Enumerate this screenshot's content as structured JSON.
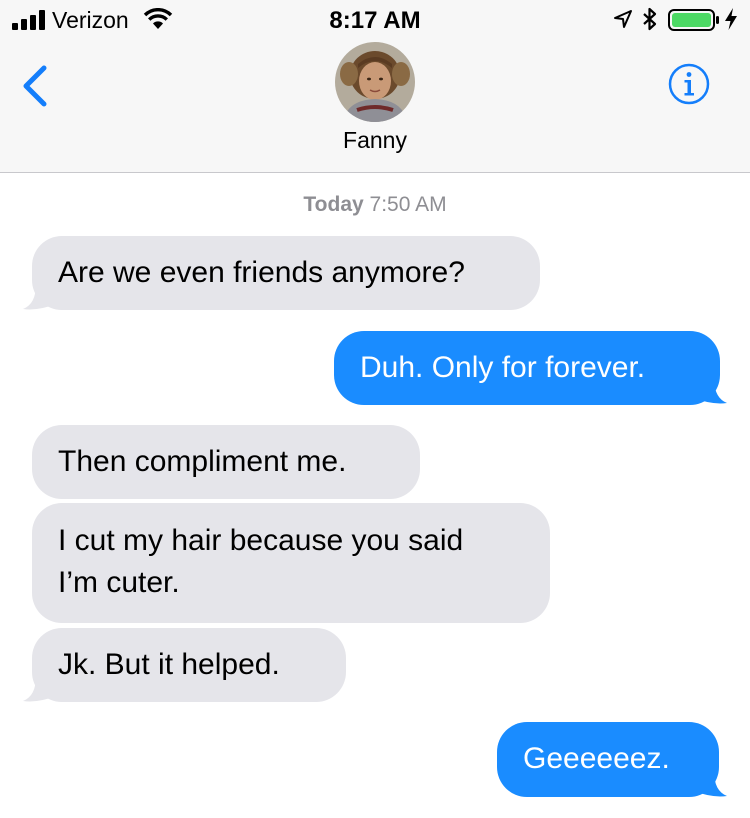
{
  "status_bar": {
    "carrier": "Verizon",
    "time": "8:17 AM"
  },
  "nav": {
    "contact_name": "Fanny",
    "accent_color": "#147efb"
  },
  "conversation": {
    "timestamp_day": "Today",
    "timestamp_time": "7:50 AM",
    "messages": [
      {
        "direction": "incoming",
        "text": "Are we even friends anymore?"
      },
      {
        "direction": "outgoing",
        "text": "Duh. Only for forever."
      },
      {
        "direction": "incoming",
        "text": "Then compliment me."
      },
      {
        "direction": "incoming",
        "line1": "I cut my hair because you said",
        "line2": "I’m cuter."
      },
      {
        "direction": "incoming",
        "text": "Jk. But it helped."
      },
      {
        "direction": "outgoing",
        "text": "Geeeeeez."
      }
    ],
    "colors": {
      "incoming_bubble": "#e5e5ea",
      "outgoing_bubble": "#1a8cff"
    }
  }
}
